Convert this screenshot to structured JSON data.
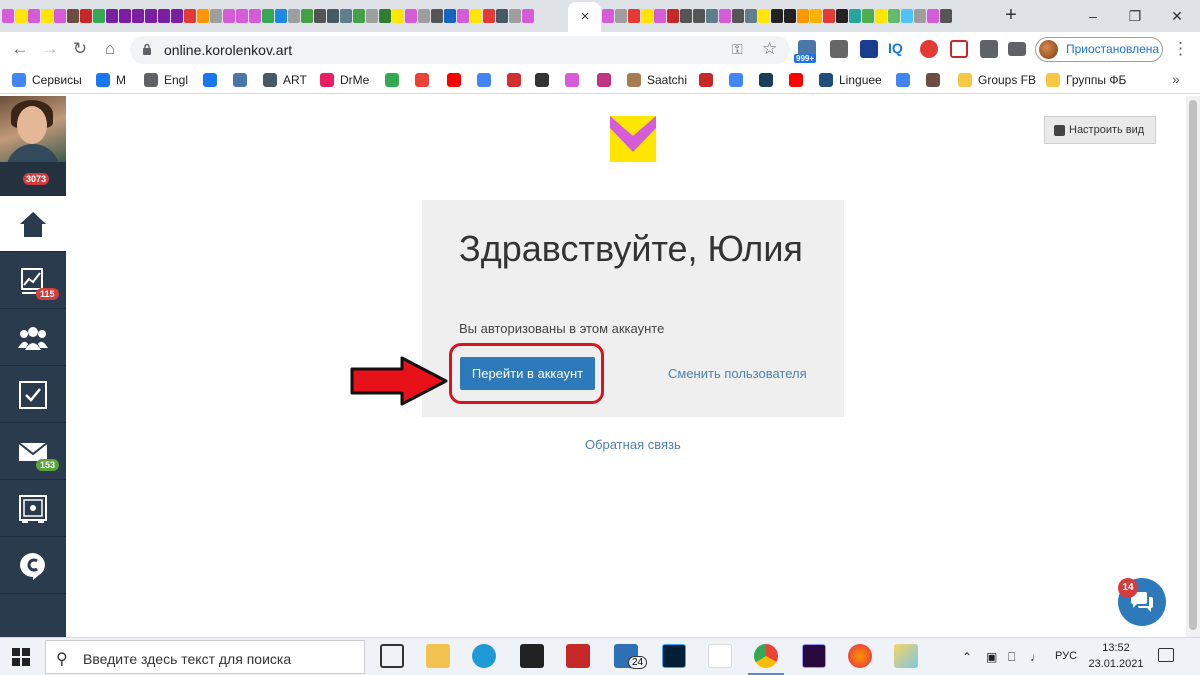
{
  "browser": {
    "url": "online.korolenkov.art",
    "profile_label": "Приостановлена",
    "ext_badge": "999+",
    "ext_iq": "IQ",
    "tab_close": "×",
    "new_tab": "+"
  },
  "bookmarks": [
    {
      "label": "Сервисы",
      "icon": "apps-grid-icon",
      "color": "#4285f4"
    },
    {
      "label": "M",
      "icon": "facebook-icon",
      "color": "#1877f2"
    },
    {
      "label": "Engl",
      "icon": "globe-icon",
      "color": "#5f6368"
    },
    {
      "label": "",
      "icon": "facebook-icon",
      "color": "#1877f2"
    },
    {
      "label": "",
      "icon": "vk-icon",
      "color": "#4a76a8"
    },
    {
      "label": "ART",
      "icon": "art-icon",
      "color": "#455a64"
    },
    {
      "label": "DrMe",
      "icon": "drme-icon",
      "color": "#e91e63"
    },
    {
      "label": "",
      "icon": "vivaldi-icon",
      "color": "#34a853"
    },
    {
      "label": "",
      "icon": "gmail-icon",
      "color": "#ea4335"
    },
    {
      "label": "",
      "icon": "yandex-icon",
      "color": "#ff0000"
    },
    {
      "label": "",
      "icon": "google-icon",
      "color": "#4285f4"
    },
    {
      "label": "",
      "icon": "square-red-icon",
      "color": "#d32f2f"
    },
    {
      "label": "",
      "icon": "hd-icon",
      "color": "#333333"
    },
    {
      "label": "",
      "icon": "v-logo-icon",
      "color": "#d65bd8"
    },
    {
      "label": "",
      "icon": "instagram-icon",
      "color": "#c13584"
    },
    {
      "label": "Saatchi",
      "icon": "saatchi-icon",
      "color": "#a67c52"
    },
    {
      "label": "",
      "icon": "red-badge-icon",
      "color": "#c62828"
    },
    {
      "label": "",
      "icon": "google-icon",
      "color": "#4285f4"
    },
    {
      "label": "",
      "icon": "t-icon",
      "color": "#1a3d5c"
    },
    {
      "label": "",
      "icon": "youtube-icon",
      "color": "#ff0000"
    },
    {
      "label": "Linguee",
      "icon": "linguee-icon",
      "color": "#1e4e79"
    },
    {
      "label": "",
      "icon": "translate-icon",
      "color": "#4285f4"
    },
    {
      "label": "",
      "icon": "y-icon",
      "color": "#6d4c41"
    },
    {
      "label": "Groups FB",
      "icon": "folder-icon",
      "color": "#f6c744"
    },
    {
      "label": "Группы ФБ",
      "icon": "folder-icon",
      "color": "#f6c744"
    }
  ],
  "sidebar": {
    "points_badge": "3073",
    "items": [
      {
        "name": "home-icon",
        "badge": ""
      },
      {
        "name": "stats-icon",
        "badge": "115"
      },
      {
        "name": "users-icon",
        "badge": ""
      },
      {
        "name": "tasks-icon",
        "badge": ""
      },
      {
        "name": "mail-icon",
        "badge": "153"
      },
      {
        "name": "safe-icon",
        "badge": ""
      },
      {
        "name": "chat-logo-icon",
        "badge": ""
      }
    ]
  },
  "main": {
    "customize_label": "Настроить вид",
    "greeting": "Здравствуйте, Юлия",
    "status_text": "Вы авторизованы в этом аккаунте",
    "goto_label": "Перейти в аккаунт",
    "switch_user_label": "Сменить пользователя",
    "feedback_label": "Обратная связь",
    "chat_badge": "14",
    "logo_colors": {
      "yellow": "#ffe600",
      "magenta": "#d65bd8"
    }
  },
  "taskbar": {
    "search_placeholder": "Введите здесь текст для поиска",
    "mail_badge": "24",
    "lang": "РУС",
    "time": "13:52",
    "date": "23.01.2021"
  },
  "colors": {
    "accent": "#2e79b9",
    "sidebar": "#2b3b4e",
    "highlight": "#d8151f",
    "badge_red": "#d43d3d",
    "badge_green": "#5aa53a"
  }
}
